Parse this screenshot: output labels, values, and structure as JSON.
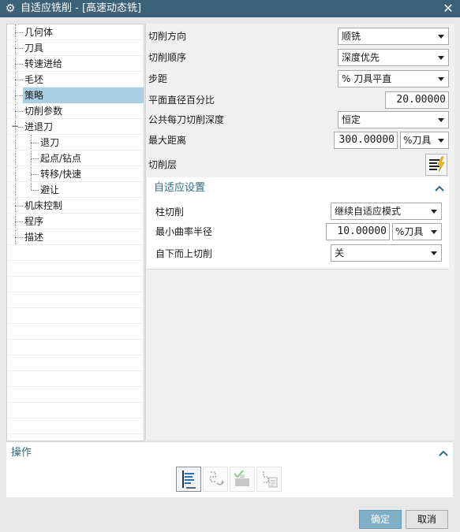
{
  "window": {
    "title": "自适应铣削 - [高速动态铣]",
    "close_glyph": "✕",
    "gear_glyph": "⚙"
  },
  "tree": {
    "items": [
      {
        "label": "几何体"
      },
      {
        "label": "刀具"
      },
      {
        "label": "转速进给"
      },
      {
        "label": "毛坯"
      },
      {
        "label": "策略",
        "selected": true
      },
      {
        "label": "切削参数"
      },
      {
        "label": "进退刀",
        "expanded": true
      },
      {
        "label": "退刀"
      },
      {
        "label": "起点/钻点"
      },
      {
        "label": "转移/快速"
      },
      {
        "label": "避让"
      },
      {
        "label": "机床控制"
      },
      {
        "label": "程序"
      },
      {
        "label": "描述"
      }
    ],
    "collapse_glyph": "−"
  },
  "params": {
    "cut_direction": {
      "label": "切削方向",
      "value": "顺铣"
    },
    "cut_order": {
      "label": "切削顺序",
      "value": "深度优先"
    },
    "stepover": {
      "label": "步距",
      "value": "% 刀具平直"
    },
    "flat_percent": {
      "label": "平面直径百分比",
      "value": "20.00000"
    },
    "common_depth": {
      "label": "公共每刀切削深度",
      "value": "恒定"
    },
    "max_distance": {
      "label": "最大距离",
      "value": "300.00000",
      "unit": "%刀具"
    },
    "cut_levels": {
      "label": "切削层"
    }
  },
  "adaptive": {
    "title": "自适应设置",
    "pillar_cut": {
      "label": "柱切削",
      "value": "继续自适应模式"
    },
    "min_curvature": {
      "label": "最小曲率半径",
      "value": "10.00000",
      "unit": "%刀具"
    },
    "bottom_up": {
      "label": "自下而上切削",
      "value": "关"
    }
  },
  "operations": {
    "title": "操作",
    "buttons": [
      "generate-icon",
      "replay-icon",
      "verify-icon",
      "list-icon"
    ]
  },
  "footer": {
    "ok": "确定",
    "cancel": "取消"
  },
  "colors": {
    "titlebar": "#3c6279",
    "accent_text": "#2e6b86",
    "selection": "#a9cfe4",
    "ok_button": "#7fb0c8"
  }
}
